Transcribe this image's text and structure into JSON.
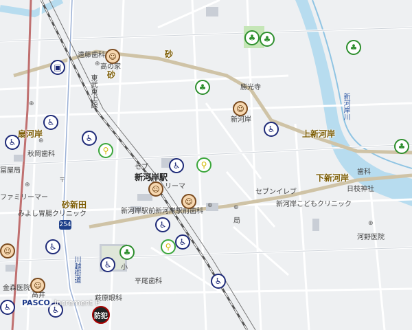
{
  "labels": {
    "station": "新河岸駅",
    "dist_suna": "砂",
    "dist_suna2": "砂",
    "dist_sunashinden": "砂新田",
    "dist_ogikawagishi": "扇河岸",
    "dist_kamishingashi": "上新河岸",
    "dist_shimoshingashi": "下新河岸",
    "river": "新河岸川",
    "route_name": "川越街道",
    "route_no": "254",
    "line_tobu": "東武東上線",
    "endo_shika": "遠藤歯科",
    "takanoya": "高の家",
    "katsuko_ji": "勝光寺",
    "shingashi": "新河岸",
    "akimoto_shika": "秋岡歯科",
    "tomiya": "冨屋局",
    "family_mart": "ファミリーマー",
    "miyoshi": "みよし胃腸クリニック",
    "seven1": "セブ",
    "shingashi_ekimae": "新河岸駅前",
    "rima": "リーマ",
    "seven2": "セブンイレブ",
    "shingashi_kodomo": "新河岸こどもクリニック",
    "hi_eda": "日枝神社",
    "shika_r": "歯科",
    "kawano": "河野医院",
    "shingashi_ekimae_shika": "新河岸駅前歯科",
    "post": "局",
    "sho": "小",
    "hirao": "平尾歯科",
    "kanamori": "金森医院",
    "hagihara": "萩原眼科",
    "takai": "高井",
    "brand": "PASCO",
    "brand_sub": "Increment P",
    "kobo": "防犯"
  },
  "icons": {
    "accessible": "wheelchair-icon",
    "bicycle": "bicycle-icon",
    "face": "person-face-icon",
    "park": "park-icon",
    "factory": "factory-icon"
  },
  "colors": {
    "background": "#eef0f2",
    "road": "#ffffff",
    "main_road": "#cfc3a6",
    "river": "#b7dcef",
    "rail": "#666666",
    "accent_blue": "#1e2a78",
    "accent_green": "#3aa63a"
  }
}
